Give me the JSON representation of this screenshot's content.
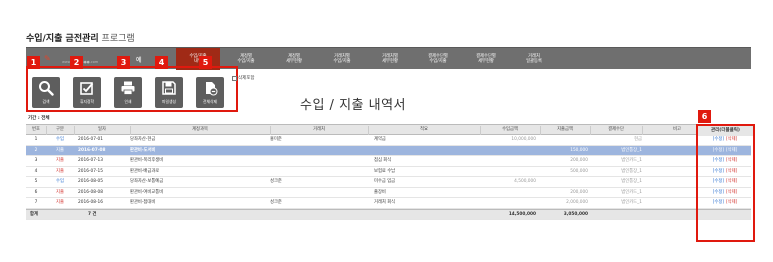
{
  "app": {
    "title": "수입/지출 금전관리",
    "subtitle": " 프로그램"
  },
  "nav": {
    "logo_url": "www.●●●●●●.com",
    "logo_tail": "예 ",
    "items": [
      {
        "label": "수입/지출\n내역"
      },
      {
        "label": "계정별\n수입/지출"
      },
      {
        "label": "계정별\n세부현황"
      },
      {
        "label": "거래처별\n수입/지출"
      },
      {
        "label": "거래처별\n세부현황"
      },
      {
        "label": "결제수단별\n수입/지출"
      },
      {
        "label": "결제수단별\n세부현황"
      },
      {
        "label": "거래처\n일괄등록"
      }
    ]
  },
  "toolbar": {
    "badges": [
      "1",
      "2",
      "3",
      "4",
      "5",
      "6"
    ],
    "search_label": "검색",
    "view_all_label": "휴지정학",
    "print_label": "인쇄",
    "file_label": "파일생성",
    "delete_all_label": "전체삭제",
    "show_deleted_label": "삭제포함",
    "icons": [
      "search-icon",
      "checkbox-edit-icon",
      "printer-icon",
      "save-icon",
      "trash-icon"
    ]
  },
  "page": {
    "heading": "수입 / 지출 내역서",
    "period_label": "기간 : 전체"
  },
  "table": {
    "columns": [
      "번호",
      "구분",
      "일자",
      "계정과목",
      "거래처",
      "적요",
      "수입금액",
      "지출금액",
      "결제수단",
      "비고",
      "관리(더블클릭)"
    ],
    "rows": [
      {
        "no": "1",
        "type": "수입",
        "date": "2016-07-01",
        "account": "당좌자산-현금",
        "vendor": "홍미준",
        "memo": "계약금",
        "income": "10,000,000",
        "expense": "",
        "method": "현금",
        "note": "",
        "edit": "[수정]",
        "del": "[삭제]"
      },
      {
        "no": "2",
        "type": "지출",
        "date": "2016-07-08",
        "account": "판관비-도서비",
        "vendor": "",
        "memo": "",
        "income": "",
        "expense": "150,000",
        "method": "법인통장_1",
        "note": "",
        "edit": "[수정]",
        "del": "[삭제]"
      },
      {
        "no": "3",
        "type": "지출",
        "date": "2016-07-13",
        "account": "판관비-복리후생비",
        "vendor": "",
        "memo": "점심 회식",
        "income": "",
        "expense": "200,000",
        "method": "법인카드_1",
        "note": "",
        "edit": "[수정]",
        "del": "[삭제]"
      },
      {
        "no": "4",
        "type": "지출",
        "date": "2016-07-15",
        "account": "판관비-배급과로",
        "vendor": "",
        "memo": "보험료 수납",
        "income": "",
        "expense": "500,000",
        "method": "법인통장_1",
        "note": "",
        "edit": "[수정]",
        "del": "[삭제]"
      },
      {
        "no": "5",
        "type": "수입",
        "date": "2016-08-05",
        "account": "당좌자산-보통예금",
        "vendor": "성크준",
        "memo": "미수금 입금",
        "income": "4,500,000",
        "expense": "",
        "method": "법인통장_1",
        "note": "",
        "edit": "[수정]",
        "del": "[삭제]"
      },
      {
        "no": "6",
        "type": "지출",
        "date": "2016-08-08",
        "account": "판관비-여비교통비",
        "vendor": "",
        "memo": "출장비",
        "income": "",
        "expense": "200,000",
        "method": "법인카드_1",
        "note": "",
        "edit": "[수정]",
        "del": "[삭제]"
      },
      {
        "no": "7",
        "type": "지출",
        "date": "2016-08-16",
        "account": "판관비-접대비",
        "vendor": "성크준",
        "memo": "거래처 회식",
        "income": "",
        "expense": "2,000,000",
        "method": "법인카드_1",
        "note": "",
        "edit": "[수정]",
        "del": "[삭제]"
      }
    ],
    "total": {
      "label": "합계",
      "count": "7 건",
      "income": "14,500,000",
      "expense": "3,050,000"
    }
  },
  "colors": {
    "accent_red": "#e0190e",
    "nav_bg": "#6f6f6f",
    "active_tab": "#a02a16",
    "selected_row": "#9db5de",
    "income": "#2a6fcf",
    "expense": "#d2322d"
  }
}
